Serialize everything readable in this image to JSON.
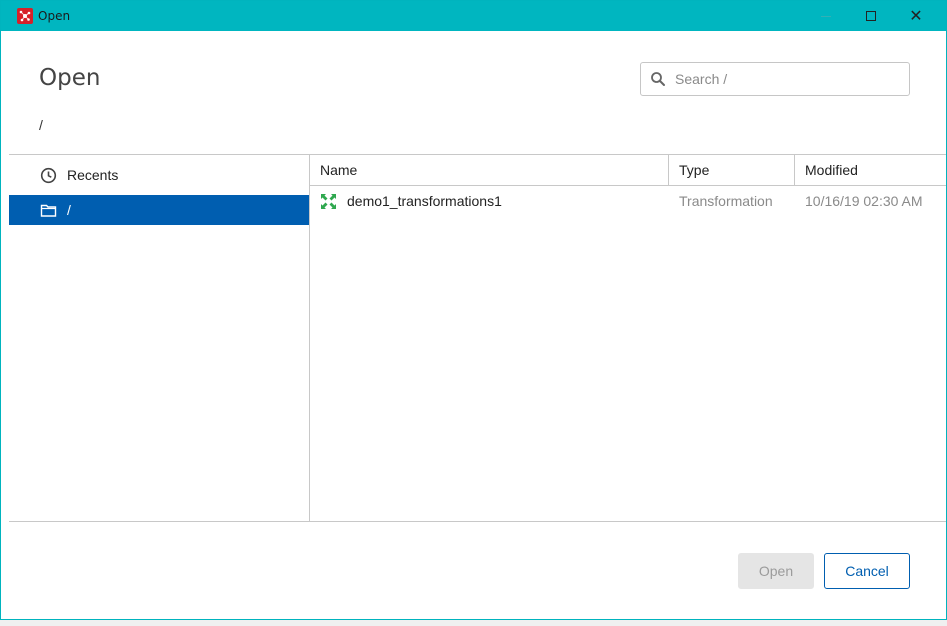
{
  "window": {
    "title": "Open",
    "title_bar_color": "#00b6c0",
    "icon": "app-logo-icon"
  },
  "dialog": {
    "heading": "Open",
    "current_path": "/"
  },
  "search": {
    "placeholder": "Search /",
    "value": ""
  },
  "sidebar": {
    "items": [
      {
        "label": "Recents",
        "icon": "clock-icon",
        "selected": false
      },
      {
        "label": "/",
        "icon": "folder-icon",
        "selected": true
      }
    ],
    "selected_color": "#005eb0"
  },
  "table": {
    "columns": [
      "Name",
      "Type",
      "Modified"
    ],
    "rows": [
      {
        "name": "demo1_transformations1",
        "type": "Transformation",
        "modified": "10/16/19 02:30 AM",
        "icon": "transformation-icon"
      }
    ]
  },
  "buttons": {
    "open_label": "Open",
    "open_enabled": false,
    "cancel_label": "Cancel"
  }
}
